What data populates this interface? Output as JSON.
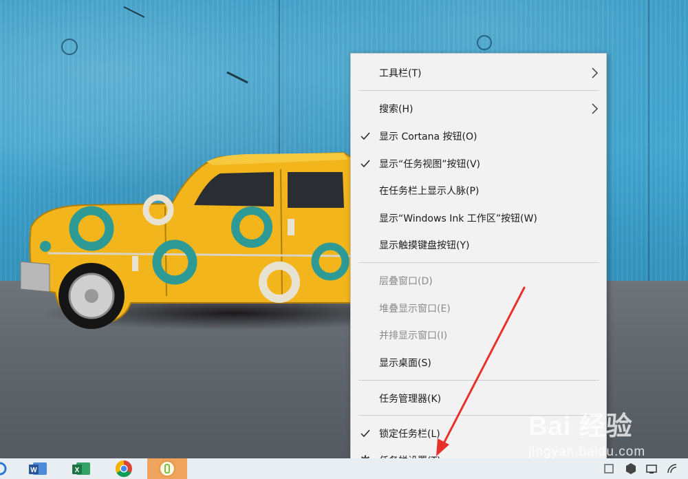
{
  "context_menu": {
    "items": [
      {
        "label": "工具栏(T)",
        "checked": false,
        "disabled": false,
        "submenu": true,
        "icon": ""
      },
      {
        "label": "搜索(H)",
        "checked": false,
        "disabled": false,
        "submenu": true,
        "icon": ""
      },
      {
        "label": "显示 Cortana 按钮(O)",
        "checked": true,
        "disabled": false,
        "submenu": false,
        "icon": "check-icon"
      },
      {
        "label": "显示“任务视图”按钮(V)",
        "checked": true,
        "disabled": false,
        "submenu": false,
        "icon": "check-icon"
      },
      {
        "label": "在任务栏上显示人脉(P)",
        "checked": false,
        "disabled": false,
        "submenu": false,
        "icon": ""
      },
      {
        "label": "显示“Windows Ink 工作区”按钮(W)",
        "checked": false,
        "disabled": false,
        "submenu": false,
        "icon": ""
      },
      {
        "label": "显示触摸键盘按钮(Y)",
        "checked": false,
        "disabled": false,
        "submenu": false,
        "icon": ""
      },
      {
        "label": "层叠窗口(D)",
        "checked": false,
        "disabled": true,
        "submenu": false,
        "icon": ""
      },
      {
        "label": "堆叠显示窗口(E)",
        "checked": false,
        "disabled": true,
        "submenu": false,
        "icon": ""
      },
      {
        "label": "并排显示窗口(I)",
        "checked": false,
        "disabled": true,
        "submenu": false,
        "icon": ""
      },
      {
        "label": "显示桌面(S)",
        "checked": false,
        "disabled": false,
        "submenu": false,
        "icon": ""
      },
      {
        "label": "任务管理器(K)",
        "checked": false,
        "disabled": false,
        "submenu": false,
        "icon": ""
      },
      {
        "label": "锁定任务栏(L)",
        "checked": true,
        "disabled": false,
        "submenu": false,
        "icon": "check-icon"
      },
      {
        "label": "任务栏设置(T)",
        "checked": false,
        "disabled": false,
        "submenu": false,
        "icon": "gear-icon"
      }
    ]
  },
  "taskbar": {
    "apps": [
      {
        "name": "Word",
        "icon": "word-icon",
        "letter": "W",
        "color": "#2b579a"
      },
      {
        "name": "Excel",
        "icon": "excel-icon",
        "letter": "X",
        "color": "#1f7244"
      },
      {
        "name": "Chrome",
        "icon": "chrome-icon"
      },
      {
        "name": "Active app",
        "icon": "active-app-icon",
        "active": true,
        "color": "#f0a35c"
      }
    ]
  },
  "watermark": {
    "brand": "Bai 经验",
    "url": "jingyan.baidu.com"
  },
  "colors": {
    "menu_bg": "#f2f2f2",
    "menu_text": "#1a1a1a",
    "menu_disabled_text": "#8a8a8a",
    "annotation_arrow": "#e8302a",
    "car_yellow": "#f2b51c",
    "ring_teal": "#2e9a96"
  }
}
